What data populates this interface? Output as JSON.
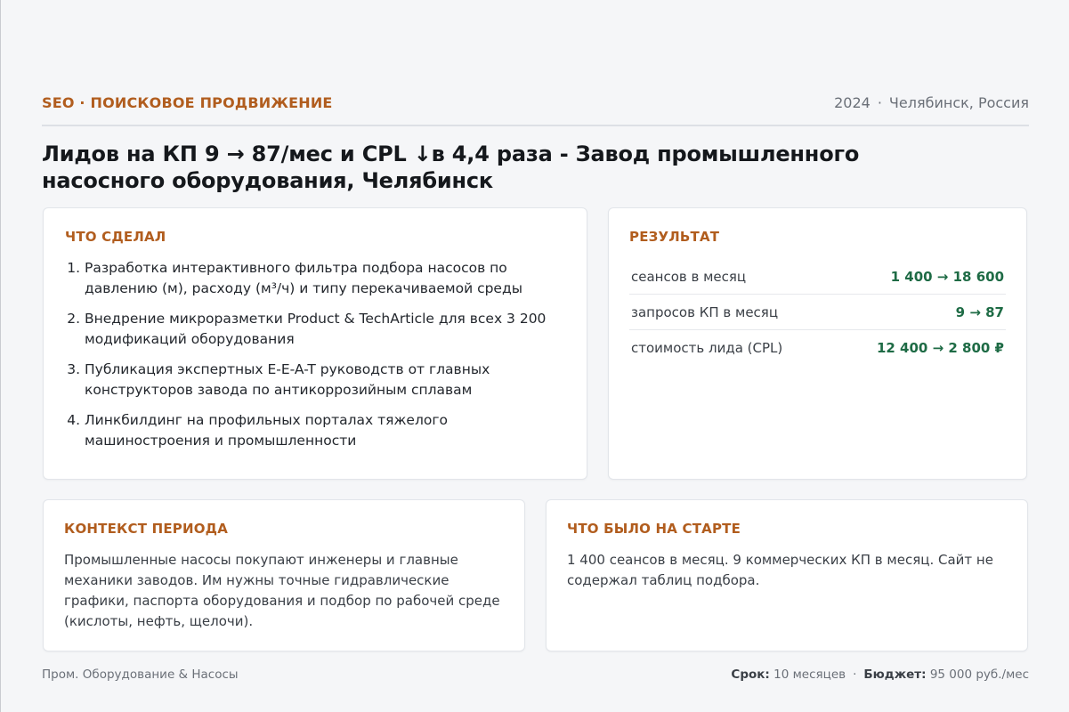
{
  "header": {
    "category": "SEO · ПОИСКОВОЕ ПРОДВИЖЕНИЕ",
    "year": "2024",
    "separator": "·",
    "location": "Челябинск, Россия"
  },
  "title": "Лидов на КП 9 → 87/мес и CPL ↓в 4,4 раза - Завод промышленного насосного оборудования, Челябинск",
  "done": {
    "heading": "ЧТО СДЕЛАЛ",
    "items": [
      "Разработка интерактивного фильтра подбора насосов по давлению (м), расходу (м³/ч) и типу перекачиваемой среды",
      "Внедрение микроразметки Product & TechArticle для всех 3 200 модификаций оборудования",
      "Публикация экспертных E-E-A-T руководств от главных конструкторов завода по антикоррозийным сплавам",
      "Линкбилдинг на профильных порталах тяжелого машиностроения и промышленности"
    ]
  },
  "result": {
    "heading": "РЕЗУЛЬТАТ",
    "rows": [
      {
        "label": "сеансов в месяц",
        "value": "1 400 → 18 600"
      },
      {
        "label": "запросов КП в месяц",
        "value": "9 → 87"
      },
      {
        "label": "стоимость лида (CPL)",
        "value": "12 400 → 2 800 ₽"
      }
    ]
  },
  "context": {
    "heading": "КОНТЕКСТ ПЕРИОДА",
    "text": "Промышленные насосы покупают инженеры и главные механики заводов. Им нужны точные гидравлические графики, паспорта оборудования и подбор по рабочей среде (кислоты, нефть, щелочи)."
  },
  "start": {
    "heading": "ЧТО БЫЛО НА СТАРТЕ",
    "text": "1 400 сеансов в месяц. 9 коммерческих КП в месяц. Сайт не содержал таблиц подбора."
  },
  "footer": {
    "industry": "Пром. Оборудование & Насосы",
    "term_label": "Срок:",
    "term_value": "10 месяцев",
    "separator": "·",
    "budget_label": "Бюджет:",
    "budget_value": "95 000 руб./мес"
  }
}
